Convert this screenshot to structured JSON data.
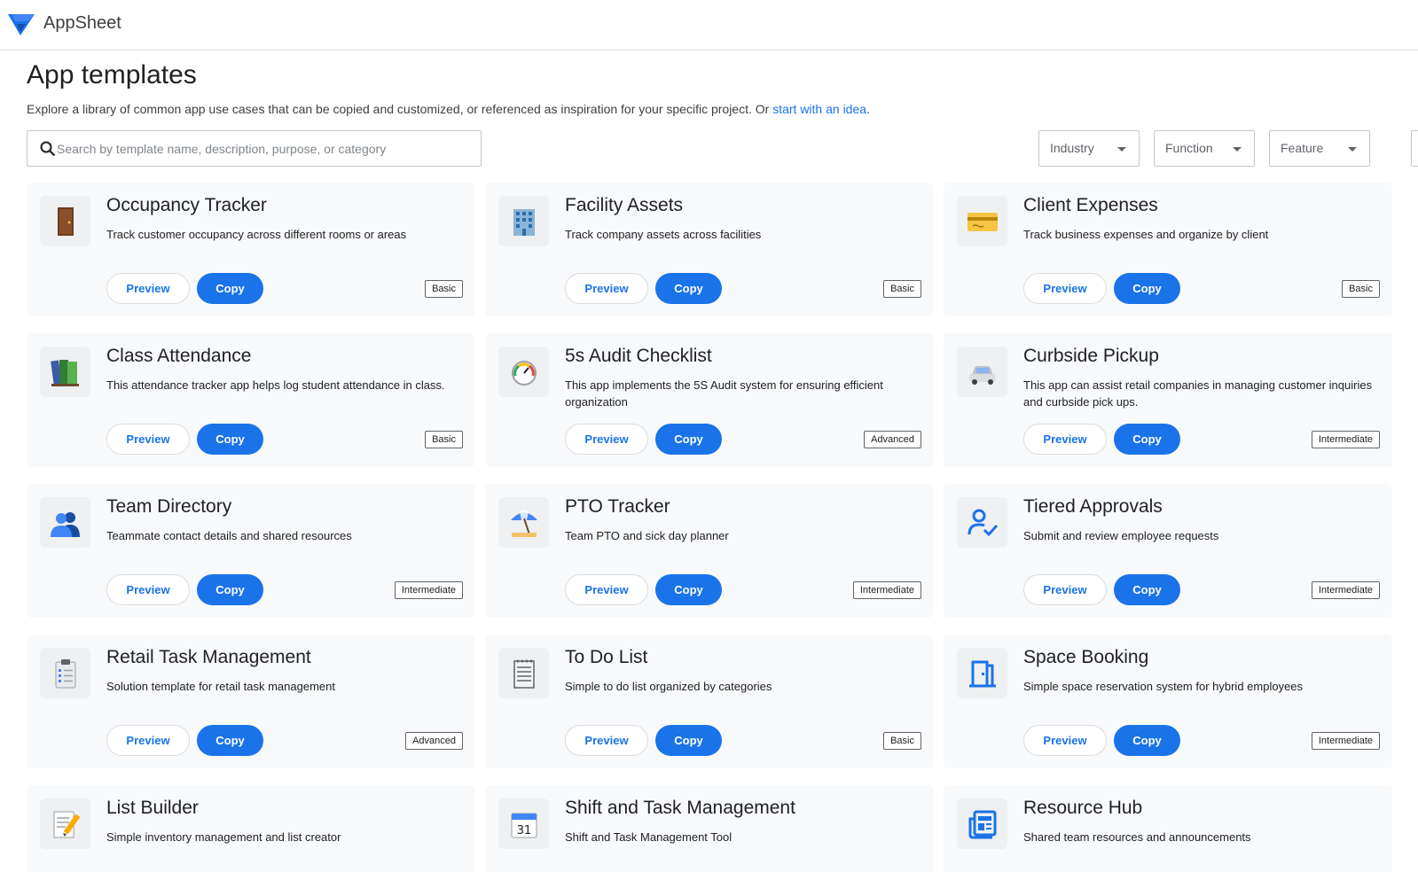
{
  "header": {
    "brand": "AppSheet"
  },
  "page": {
    "title": "App templates",
    "subtitle_text": "Explore a library of common app use cases that can be copied and customized, or referenced as inspiration for your specific project. Or ",
    "subtitle_link": "start with an idea",
    "subtitle_end": "."
  },
  "search": {
    "placeholder": "Search by template name, description, purpose, or category"
  },
  "filters": [
    {
      "label": "Industry"
    },
    {
      "label": "Function"
    },
    {
      "label": "Feature"
    }
  ],
  "buttons": {
    "preview": "Preview",
    "copy": "Copy"
  },
  "colors": {
    "accent": "#1a73e8",
    "card_bg": "#f8f9fa"
  },
  "cards": [
    {
      "title": "Occupancy Tracker",
      "desc": "Track customer occupancy across different rooms or areas",
      "level": "Basic",
      "icon": "door-icon"
    },
    {
      "title": "Facility Assets",
      "desc": "Track company assets across facilities",
      "level": "Basic",
      "icon": "office-building-icon"
    },
    {
      "title": "Client Expenses",
      "desc": "Track business expenses and organize by client",
      "level": "Basic",
      "icon": "credit-card-icon"
    },
    {
      "title": "Class Attendance",
      "desc": "This attendance tracker app helps log student attendance in class.",
      "level": "Basic",
      "icon": "books-icon"
    },
    {
      "title": "5s Audit Checklist",
      "desc": "This app implements the 5S Audit system for ensuring efficient organization",
      "level": "Advanced",
      "icon": "gauge-icon"
    },
    {
      "title": "Curbside Pickup",
      "desc": "This app can assist retail companies in managing customer inquiries and curbside pick ups.",
      "level": "Intermediate",
      "icon": "car-icon"
    },
    {
      "title": "Team Directory",
      "desc": "Teammate contact details and shared resources",
      "level": "Intermediate",
      "icon": "people-icon"
    },
    {
      "title": "PTO Tracker",
      "desc": "Team PTO and sick day planner",
      "level": "Intermediate",
      "icon": "beach-umbrella-icon"
    },
    {
      "title": "Tiered Approvals",
      "desc": "Submit and review employee requests",
      "level": "Intermediate",
      "icon": "person-check-icon"
    },
    {
      "title": "Retail Task Management",
      "desc": "Solution template for retail task management",
      "level": "Advanced",
      "icon": "clipboard-icon"
    },
    {
      "title": "To Do List",
      "desc": "Simple to do list organized by categories",
      "level": "Basic",
      "icon": "notepad-icon"
    },
    {
      "title": "Space Booking",
      "desc": "Simple space reservation system for hybrid employees",
      "level": "Intermediate",
      "icon": "door-open-icon"
    },
    {
      "title": "List Builder",
      "desc": "Simple inventory management and list creator",
      "level": "",
      "icon": "memo-pencil-icon"
    },
    {
      "title": "Shift and Task Management",
      "desc": "Shift and Task Management Tool",
      "level": "",
      "icon": "calendar-icon",
      "icon_text": "31"
    },
    {
      "title": "Resource Hub",
      "desc": "Shared team resources and announcements",
      "level": "",
      "icon": "newspaper-icon"
    }
  ]
}
